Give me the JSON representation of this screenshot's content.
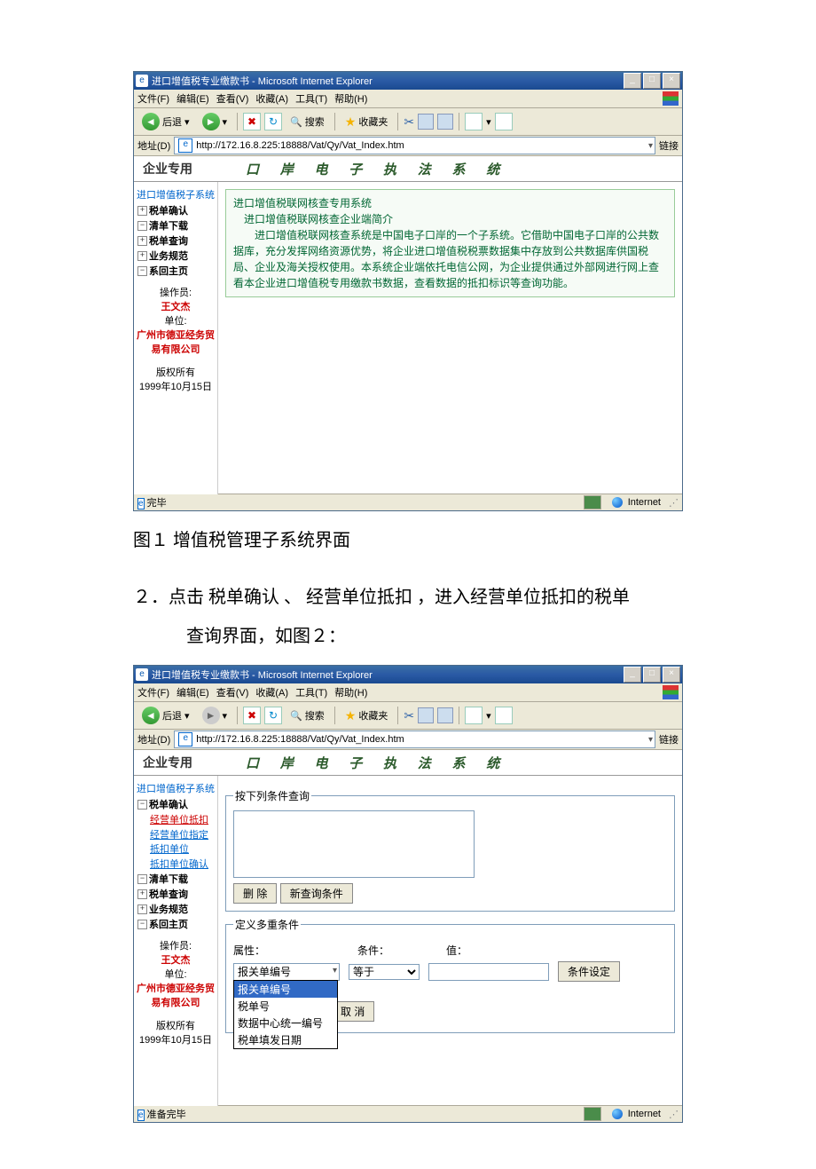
{
  "window1": {
    "title": "进口增值税专业缴款书 - Microsoft Internet Explorer",
    "menus": [
      "文件(F)",
      "编辑(E)",
      "查看(V)",
      "收藏(A)",
      "工具(T)",
      "帮助(H)"
    ],
    "back": "后退",
    "search": "搜索",
    "favorites": "收藏夹",
    "address_label": "地址(D)",
    "url": "http://172.16.8.225:18888/Vat/Qy/Vat_Index.htm",
    "links_label": "链接",
    "header_left": "企业专用",
    "header_center": "口 岸 电 子 执 法 系 统",
    "sidebar": {
      "system": "进口增值税子系统",
      "items": [
        "税单确认",
        "清单下载",
        "税单查询",
        "业务规范",
        "系回主页"
      ],
      "op_label": "操作员:",
      "op_name": "王文杰",
      "unit_label": "单位:",
      "unit_name": "广州市德亚经务贸易有限公司",
      "copyright1": "版权所有",
      "copyright2": "1999年10月15日"
    },
    "info": {
      "line1": "进口增值税联网核查专用系统",
      "line2": "进口增值税联网核查企业端简介",
      "body": "进口增值税联网核查系统是中国电子口岸的一个子系统。它借助中国电子口岸的公共数据库，充分发挥网络资源优势，将企业进口增值税税票数据集中存放到公共数据库供国税局、企业及海关授权使用。本系统企业端依托电信公网，为企业提供通过外部网进行网上查看本企业进口增值税专用缴款书数据，查看数据的抵扣标识等查询功能。"
    },
    "status_done": "完毕",
    "status_internet": "Internet"
  },
  "caption1": "图１ 增值税管理子系统界面",
  "para1": "２．点击 税单确认 、 经营单位抵扣 ，进入经营单位抵扣的税单",
  "para1b": "查询界面，如图２：",
  "window2": {
    "title": "进口增值税专业缴款书 - Microsoft Internet Explorer",
    "menus": [
      "文件(F)",
      "编辑(E)",
      "查看(V)",
      "收藏(A)",
      "工具(T)",
      "帮助(H)"
    ],
    "back": "后退",
    "search": "搜索",
    "favorites": "收藏夹",
    "address_label": "地址(D)",
    "url": "http://172.16.8.225:18888/Vat/Qy/Vat_Index.htm",
    "links_label": "链接",
    "header_left": "企业专用",
    "header_center": "口 岸 电 子 执 法 系 统",
    "sidebar": {
      "system": "进口增值税子系统",
      "tax_confirm": "税单确认",
      "subs": [
        "经营单位抵扣",
        "经营单位指定抵扣单位",
        "抵扣单位确认"
      ],
      "items": [
        "清单下载",
        "税单查询",
        "业务规范",
        "系回主页"
      ],
      "op_label": "操作员:",
      "op_name": "王文杰",
      "unit_label": "单位:",
      "unit_name": "广州市德亚经务贸易有限公司",
      "copyright1": "版权所有",
      "copyright2": "1999年10月15日"
    },
    "fieldset1": {
      "legend": "按下列条件查询",
      "btn_delete": "删 除",
      "btn_new": "新查询条件"
    },
    "fieldset2": {
      "legend": "定义多重条件",
      "attr_label": "属性：",
      "cond_label": "条件：",
      "value_label": "值：",
      "attr_selected": "报关单编号",
      "cond_options": [
        "等于"
      ],
      "btn_set": "条件设定",
      "dropdown": [
        "报关单编号",
        "税单号",
        "数据中心统一编号",
        "税单填发日期"
      ],
      "btn_cancel": "取 消"
    },
    "status_done": "准备完毕",
    "status_internet": "Internet"
  }
}
